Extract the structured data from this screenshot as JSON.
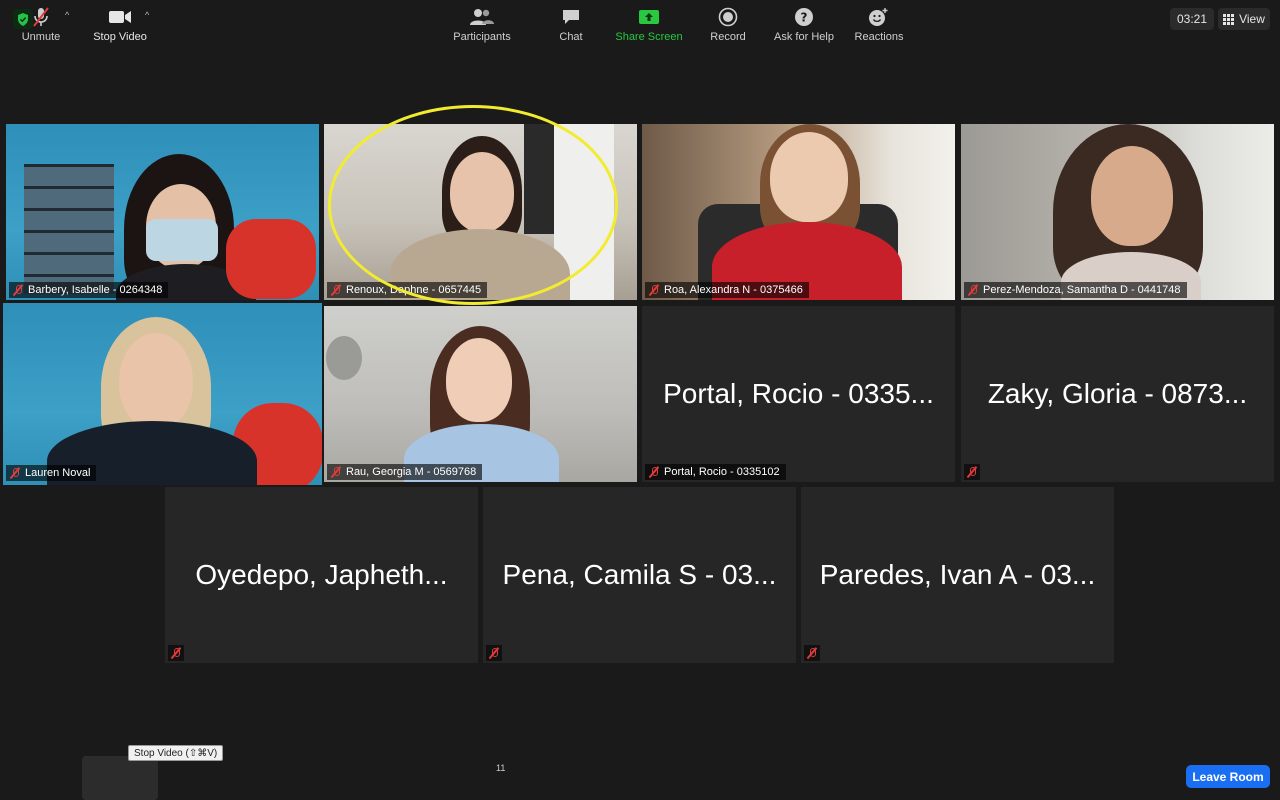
{
  "window": {
    "timer": "03:21",
    "view_label": "View"
  },
  "participants": [
    {
      "name": "Barbery, Isabelle - 0264348",
      "big": ""
    },
    {
      "name": "Renoux, Daphne - 0657445",
      "big": ""
    },
    {
      "name": "Roa, Alexandra N - 0375466",
      "big": ""
    },
    {
      "name": "Perez-Mendoza, Samantha D - 0441748",
      "big": ""
    },
    {
      "name": "Lauren Noval",
      "big": ""
    },
    {
      "name": "Rau, Georgia M - 0569768",
      "big": ""
    },
    {
      "name": "Portal, Rocio - 0335102",
      "big": "Portal, Rocio - 0335..."
    },
    {
      "name": "",
      "big": "Zaky, Gloria - 0873..."
    },
    {
      "name": "",
      "big": "Oyedepo, Japheth..."
    },
    {
      "name": "",
      "big": "Pena, Camila S - 03..."
    },
    {
      "name": "",
      "big": "Paredes, Ivan A - 03..."
    }
  ],
  "toolbar": {
    "unmute": "Unmute",
    "stop_video": "Stop Video",
    "tooltip": "Stop Video (⇧⌘V)",
    "participants": "Participants",
    "participants_count": "11",
    "chat": "Chat",
    "share_screen": "Share Screen",
    "record": "Record",
    "ask_for_help": "Ask for Help",
    "reactions": "Reactions",
    "leave_room": "Leave Room"
  },
  "colors": {
    "active_speaker": "#c7e27a",
    "highlight_ring": "#f2ec2e",
    "share_green": "#28c840",
    "leave_blue": "#1a6ef2",
    "muted_red": "#e23b3b"
  }
}
